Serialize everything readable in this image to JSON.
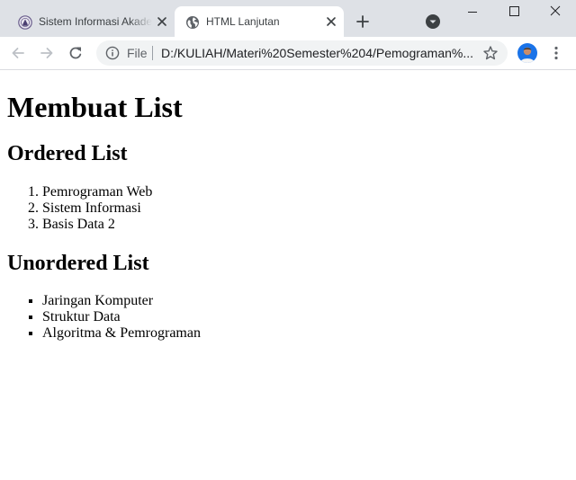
{
  "browser": {
    "tabs": [
      {
        "title": "Sistem Informasi Akademik",
        "active": false,
        "favicon": "university-logo-icon"
      },
      {
        "title": "HTML Lanjutan",
        "active": true,
        "favicon": "globe-icon"
      }
    ],
    "address_bar": {
      "scheme_label": "File",
      "url": "D:/KULIAH/Materi%20Semester%204/Pemograman%..."
    }
  },
  "page": {
    "title": "Membuat List",
    "ordered_heading": "Ordered List",
    "ordered_items": [
      "Pemrograman Web",
      "Sistem Informasi",
      "Basis Data 2"
    ],
    "unordered_heading": "Unordered List",
    "unordered_items": [
      "Jaringan Komputer",
      "Struktur Data",
      "Algoritma & Pemrograman"
    ]
  },
  "colors": {
    "tabstrip_bg": "#dee1e6",
    "active_tab_bg": "#ffffff",
    "omnibox_bg": "#f1f3f4",
    "icon_color": "#5f6368",
    "avatar_bg": "#1a73e8"
  }
}
